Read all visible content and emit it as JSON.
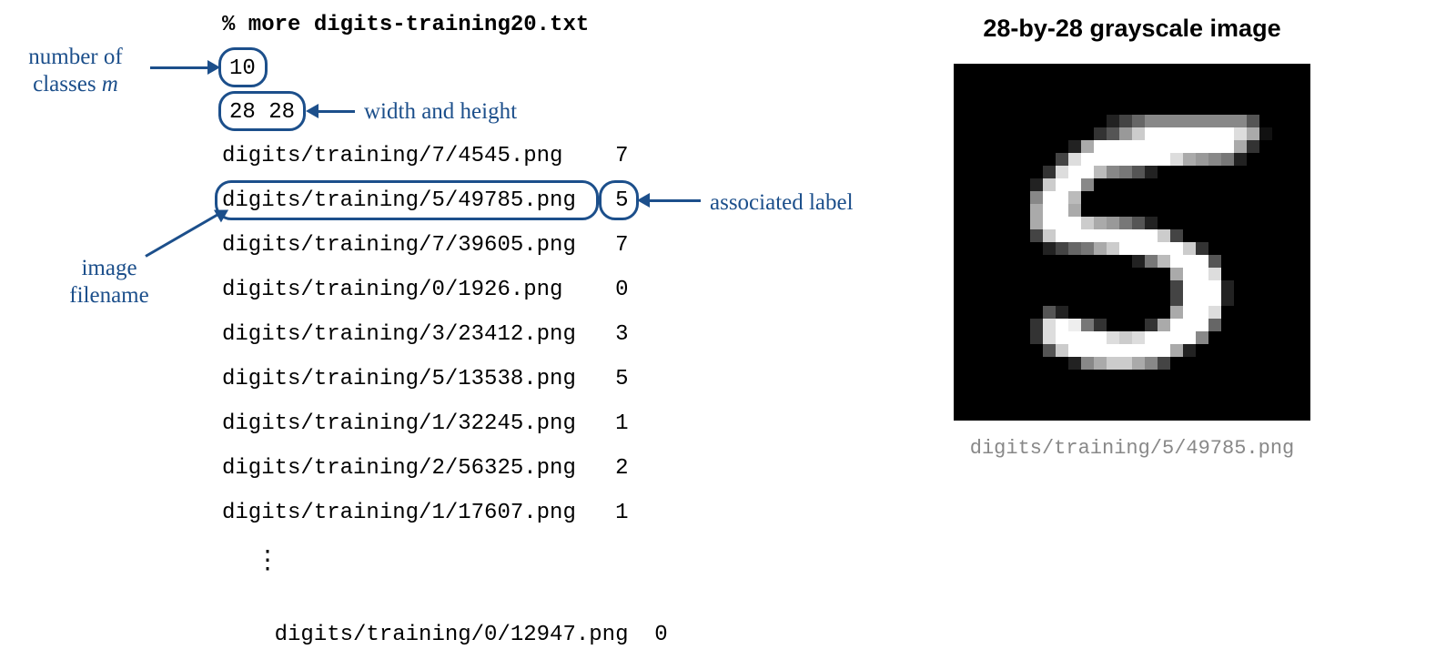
{
  "command": "% more digits-training20.txt",
  "header_lines": {
    "classes": "10",
    "dims": "28 28"
  },
  "rows": [
    {
      "file": "digits/training/7/4545.png",
      "label": "7"
    },
    {
      "file": "digits/training/5/49785.png",
      "label": "5"
    },
    {
      "file": "digits/training/7/39605.png",
      "label": "7"
    },
    {
      "file": "digits/training/0/1926.png",
      "label": "0"
    },
    {
      "file": "digits/training/3/23412.png",
      "label": "3"
    },
    {
      "file": "digits/training/5/13538.png",
      "label": "5"
    },
    {
      "file": "digits/training/1/32245.png",
      "label": "1"
    },
    {
      "file": "digits/training/2/56325.png",
      "label": "2"
    },
    {
      "file": "digits/training/1/17607.png",
      "label": "1"
    }
  ],
  "last_row": {
    "file": "digits/training/0/12947.png",
    "label": "0"
  },
  "annotations": {
    "classes_line1": "number of",
    "classes_line2_prefix": "classes ",
    "classes_line2_var": "m",
    "dims": "width and height",
    "filename_line1": "image",
    "filename_line2": "filename",
    "label": "associated label"
  },
  "image_panel": {
    "title": "28-by-28 grayscale image",
    "caption": "digits/training/5/49785.png"
  },
  "digit_pixels": [
    "0000000000000000000000000000",
    "0000000000000000000000000000",
    "0000000000000000000000000000",
    "0000000000000000000000000000",
    "0000000000002468888888850000",
    "00000000000359CFFFFFFFDA1000",
    "0000000002AFFFFFFFFFFFA30000",
    "000000004DFFFFFFFDA987200000",
    "00000003DFFB87520000000000000",
    "0000002CFF800000000000000000",
    "0000008FFB000000000000000000",
    "000000AFFA000000000000000000",
    "000000AFFFCA9752000000000000",
    "0000004CFFFFFFFFC40000000000",
    "00000002467ACFFFFFC300000000",
    "0000000000000027BFFF50000000",
    "00000000000000000AFFD0000000",
    "000000000000000004FFF2000000",
    "000000000000000004FFF2000000",
    "00000005200000000AFFD0000000",
    "0000003DFE730003AFFF60000000",
    "0000003DFFFFDCDFFFF800000000",
    "00000005CFFFFFFFFA2000000000",
    "00000000028ACCA8400000000000",
    "0000000000000000000000000000",
    "0000000000000000000000000000",
    "0000000000000000000000000000",
    "0000000000000000000000000000"
  ]
}
